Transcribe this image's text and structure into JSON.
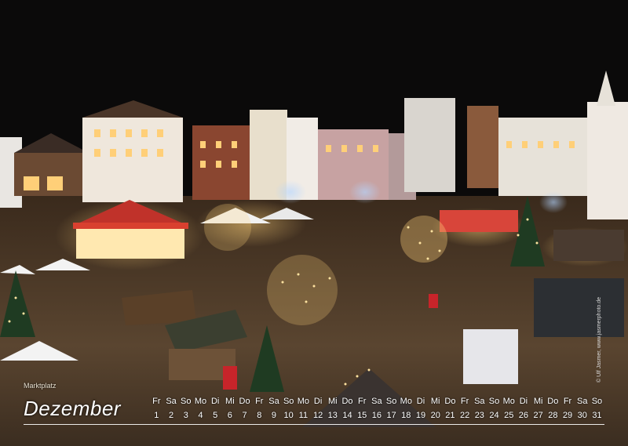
{
  "calendar": {
    "location": "Marktplatz",
    "month": "Dezember",
    "credit": "© Ulf Jasmer, www.jasmerphoto.de",
    "weekdays": [
      "Fr",
      "Sa",
      "So",
      "Mo",
      "Di",
      "Mi",
      "Do",
      "Fr",
      "Sa",
      "So",
      "Mo",
      "Di",
      "Mi",
      "Do",
      "Fr",
      "Sa",
      "So",
      "Mo",
      "Di",
      "Mi",
      "Do",
      "Fr",
      "Sa",
      "So",
      "Mo",
      "Di",
      "Mi",
      "Do",
      "Fr",
      "Sa",
      "So"
    ],
    "days": [
      "1",
      "2",
      "3",
      "4",
      "5",
      "6",
      "7",
      "8",
      "9",
      "10",
      "11",
      "12",
      "13",
      "14",
      "15",
      "16",
      "17",
      "18",
      "19",
      "20",
      "21",
      "22",
      "23",
      "24",
      "25",
      "26",
      "27",
      "28",
      "29",
      "30",
      "31"
    ]
  },
  "colors": {
    "sky": "#0b0a0a",
    "carousel_roof": "#c0322a",
    "warm_light": "#ffd27a",
    "cool_light": "#9fc8ff"
  }
}
